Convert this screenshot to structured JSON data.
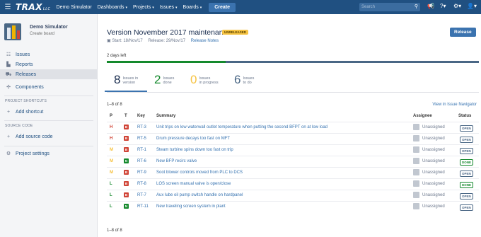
{
  "topnav": {
    "logo": "TRAX",
    "logo_suffix": "LLC",
    "site_name": "Demo Simulator",
    "menu": [
      {
        "label": "Dashboards"
      },
      {
        "label": "Projects"
      },
      {
        "label": "Issues"
      },
      {
        "label": "Boards"
      }
    ],
    "create_label": "Create",
    "search_placeholder": "Search"
  },
  "sidebar": {
    "project_name": "Demo Simulator",
    "project_sub": "Create board",
    "nav": [
      {
        "label": "Issues",
        "icon": "issues-icon"
      },
      {
        "label": "Reports",
        "icon": "reports-icon"
      },
      {
        "label": "Releases",
        "icon": "releases-icon"
      },
      {
        "label": "Components",
        "icon": "components-icon"
      }
    ],
    "shortcuts_label": "PROJECT SHORTCUTS",
    "add_shortcut": "Add shortcut",
    "source_label": "SOURCE CODE",
    "add_source": "Add source code",
    "settings": "Project settings"
  },
  "version": {
    "title": "Version November 2017 maintenance",
    "badge": "UNRELEASED",
    "start": "Start: 18/Nov/17",
    "release": "Release: 29/Nov/17",
    "notes": "Release Notes",
    "release_button": "Release",
    "days_left": "2 days left",
    "progress_fraction": 0.32
  },
  "stats": [
    {
      "num": "8",
      "l1": "Issues in",
      "l2": "version",
      "color": "#172b4d"
    },
    {
      "num": "2",
      "l1": "Issues",
      "l2": "done",
      "color": "#14892c"
    },
    {
      "num": "0",
      "l1": "Issues",
      "l2": "in progress",
      "color": "#f6c342"
    },
    {
      "num": "6",
      "l1": "Issues",
      "l2": "to do",
      "color": "#4a6785"
    }
  ],
  "list": {
    "count_top": "1–8 of 8",
    "count_bottom": "1–8 of 8",
    "view_navigator": "View in Issue Navigator",
    "headers": {
      "p": "P",
      "t": "T",
      "key": "Key",
      "summary": "Summary",
      "assignee": "Assignee",
      "status": "Status"
    },
    "rows": [
      {
        "p": "H",
        "pcolor": "#d04437",
        "t": "B",
        "tcolor": "#d04437",
        "key": "RT-3",
        "summary": "Unit trips on low waterwall outlet temperature when putting the second BFPT on at low load",
        "assignee": "Unassigned",
        "status": "OPEN",
        "scolor": "#4a6785"
      },
      {
        "p": "H",
        "pcolor": "#d04437",
        "t": "B",
        "tcolor": "#d04437",
        "key": "RT-5",
        "summary": "Drum pressure decays too fast on MFT",
        "assignee": "Unassigned",
        "status": "OPEN",
        "scolor": "#4a6785"
      },
      {
        "p": "M",
        "pcolor": "#f6c342",
        "t": "B",
        "tcolor": "#d04437",
        "key": "RT-1",
        "summary": "Steam turbine spins down too fast on trip",
        "assignee": "Unassigned",
        "status": "OPEN",
        "scolor": "#4a6785"
      },
      {
        "p": "M",
        "pcolor": "#f6c342",
        "t": "N",
        "tcolor": "#14892c",
        "key": "RT-6",
        "summary": "New BFP recirc valve",
        "assignee": "Unassigned",
        "status": "DONE",
        "scolor": "#14892c"
      },
      {
        "p": "M",
        "pcolor": "#f6c342",
        "t": "B",
        "tcolor": "#d04437",
        "key": "RT-9",
        "summary": "Soot blower controls moved from PLC to DCS",
        "assignee": "Unassigned",
        "status": "OPEN",
        "scolor": "#4a6785"
      },
      {
        "p": "L",
        "pcolor": "#14892c",
        "t": "B",
        "tcolor": "#d04437",
        "key": "RT-8",
        "summary": "LOS screen manual valve is open/close",
        "assignee": "Unassigned",
        "status": "DONE",
        "scolor": "#14892c"
      },
      {
        "p": "L",
        "pcolor": "#14892c",
        "t": "B",
        "tcolor": "#d04437",
        "key": "RT-7",
        "summary": "Aux lube oil pump switch handle on hardpanel",
        "assignee": "Unassigned",
        "status": "OPEN",
        "scolor": "#4a6785"
      },
      {
        "p": "L",
        "pcolor": "#14892c",
        "t": "N",
        "tcolor": "#14892c",
        "key": "RT-11",
        "summary": "New traveling screen system in plant",
        "assignee": "Unassigned",
        "status": "OPEN",
        "scolor": "#4a6785"
      }
    ]
  }
}
